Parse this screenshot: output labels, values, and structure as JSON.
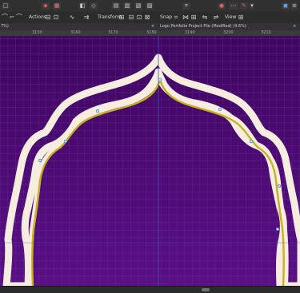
{
  "toolbar": {
    "actions_label": "Actions",
    "transform_label": "Transform",
    "snap_label": "Snap",
    "view_label": "View"
  },
  "tabs": {
    "zoom_tab": "7%)",
    "document_title": "Logo Portfolio Project File (Modified) (4.6%)"
  },
  "ruler": {
    "ticks": [
      "3150",
      "3160",
      "3170",
      "3180",
      "3190",
      "3200",
      "3210"
    ]
  },
  "colors": {
    "canvas_purple": "#4a0a6e",
    "grid_line": "#6a2a95",
    "guide_line": "#3a56c0",
    "shape_fill": "#f6ece0",
    "selection_path": "#c8b020",
    "node_color": "#bfe4ff"
  },
  "icons": [
    "undo-icon",
    "redo-icon",
    "move-icon",
    "node-tool-icon",
    "align-icon",
    "snap-icon",
    "view-icon",
    "persona-icon",
    "arrow-icon"
  ]
}
